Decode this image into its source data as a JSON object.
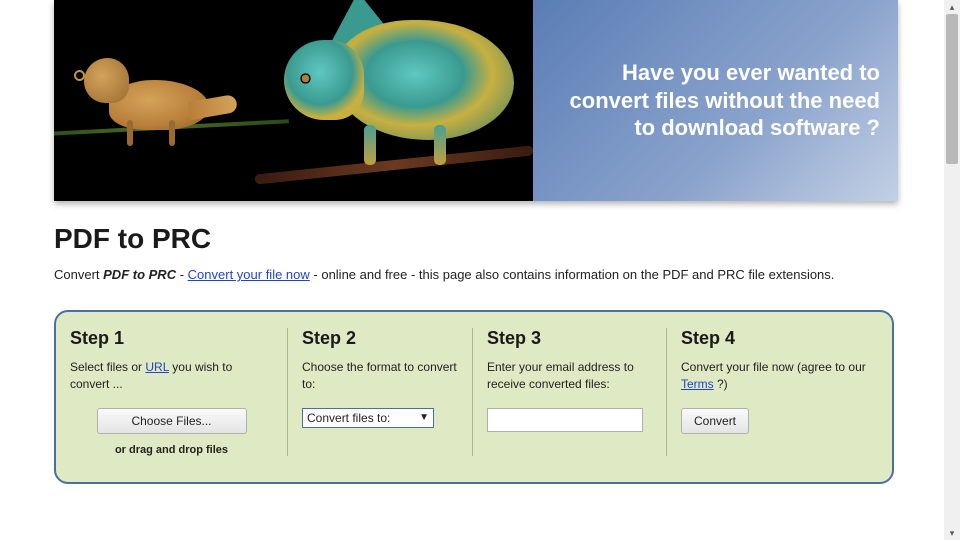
{
  "banner": {
    "tagline": "Have you ever wanted to convert files without the need to download software ?"
  },
  "page": {
    "title": "PDF to PRC",
    "intro_prefix": "Convert ",
    "intro_bold": "PDF to PRC",
    "intro_dash": " - ",
    "intro_link": "Convert your file now",
    "intro_suffix": " - online and free - this page also contains information on the PDF and PRC file extensions."
  },
  "steps": {
    "s1": {
      "title": "Step 1",
      "desc_pre": "Select files or ",
      "desc_link": "URL",
      "desc_post": " you wish to convert ...",
      "choose_label": "Choose Files...",
      "dnd": "or drag and drop files"
    },
    "s2": {
      "title": "Step 2",
      "desc": "Choose the format to convert to:",
      "select_label": "Convert files to:"
    },
    "s3": {
      "title": "Step 3",
      "desc": "Enter your email address to receive converted files:",
      "email_value": ""
    },
    "s4": {
      "title": "Step 4",
      "desc_pre": "Convert your file now (agree to our ",
      "desc_link": "Terms",
      "desc_post": " ?)",
      "convert_label": "Convert"
    }
  }
}
